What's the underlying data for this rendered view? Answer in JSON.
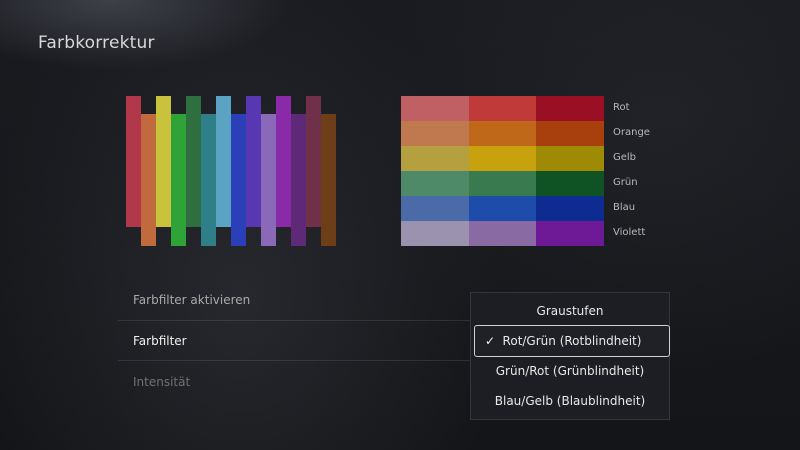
{
  "screen": {
    "title": "Farbkorrektur"
  },
  "bars": [
    {
      "name": "bar-red",
      "color": "#b0384a"
    },
    {
      "name": "bar-orange",
      "color": "#c06a3e"
    },
    {
      "name": "bar-yellow",
      "color": "#c9c23c"
    },
    {
      "name": "bar-green",
      "color": "#2fa338"
    },
    {
      "name": "bar-darkgreen",
      "color": "#2f6e3e"
    },
    {
      "name": "bar-teal",
      "color": "#2e7f88"
    },
    {
      "name": "bar-lightblue",
      "color": "#5aa3c2"
    },
    {
      "name": "bar-blue",
      "color": "#2a3fb8"
    },
    {
      "name": "bar-indigo",
      "color": "#5838b2"
    },
    {
      "name": "bar-lavender",
      "color": "#8a69b8"
    },
    {
      "name": "bar-purple",
      "color": "#8b2aa8"
    },
    {
      "name": "bar-darkpurple",
      "color": "#5e2a78"
    },
    {
      "name": "bar-maroon",
      "color": "#70304a"
    },
    {
      "name": "bar-brown",
      "color": "#6e3e18"
    }
  ],
  "color_grid": {
    "rows": [
      {
        "label": "Rot",
        "colors": [
          "#c06065",
          "#c03a3a",
          "#9a0f24"
        ]
      },
      {
        "label": "Orange",
        "colors": [
          "#c0784e",
          "#c0681a",
          "#a8400e"
        ]
      },
      {
        "label": "Gelb",
        "colors": [
          "#b5a040",
          "#c8a10f",
          "#9f8a06"
        ]
      },
      {
        "label": "Grün",
        "colors": [
          "#4f8a68",
          "#3a7a4f",
          "#0f5224"
        ]
      },
      {
        "label": "Blau",
        "colors": [
          "#4a6aa8",
          "#1e4caa",
          "#0e2b92"
        ]
      },
      {
        "label": "Violett",
        "colors": [
          "#9a92ae",
          "#8a6aa2",
          "#6e1a96"
        ]
      }
    ]
  },
  "settings": {
    "filter_enable": "Farbfilter aktivieren",
    "filter": "Farbfilter",
    "intensity": "Intensität"
  },
  "dropdown": {
    "options": [
      {
        "label": "Graustufen",
        "selected": false
      },
      {
        "label": "Rot/Grün (Rotblindheit)",
        "selected": true
      },
      {
        "label": "Grün/Rot (Grünblindheit)",
        "selected": false
      },
      {
        "label": "Blau/Gelb (Blaublindheit)",
        "selected": false
      }
    ],
    "check_icon": "✓"
  }
}
